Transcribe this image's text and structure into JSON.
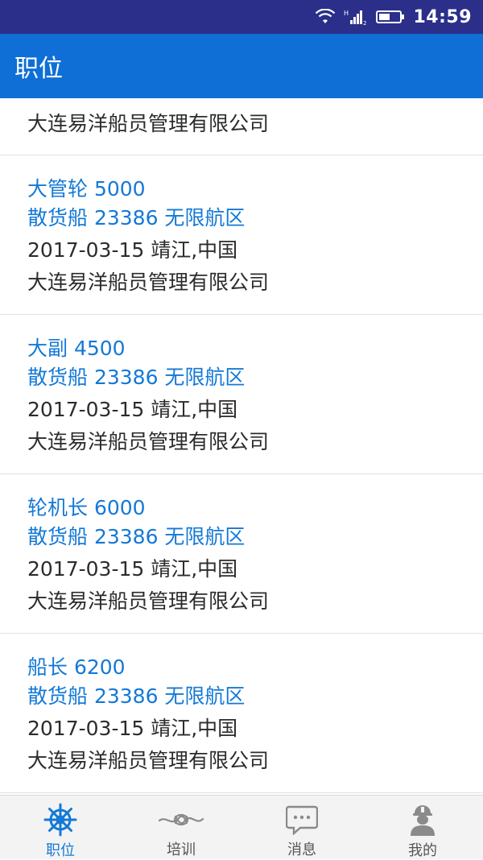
{
  "status": {
    "time": "14:59"
  },
  "appbar": {
    "title": "职位"
  },
  "jobs": [
    {
      "company": "大连易洋船员管理有限公司"
    },
    {
      "position": "大管轮 5000",
      "ship": "散货船 23386 无限航区",
      "date_place": "2017-03-15 靖江,中国",
      "company": "大连易洋船员管理有限公司"
    },
    {
      "position": "大副 4500",
      "ship": "散货船 23386 无限航区",
      "date_place": "2017-03-15 靖江,中国",
      "company": "大连易洋船员管理有限公司"
    },
    {
      "position": "轮机长 6000",
      "ship": "散货船 23386 无限航区",
      "date_place": "2017-03-15 靖江,中国",
      "company": "大连易洋船员管理有限公司"
    },
    {
      "position": "船长 6200",
      "ship": "散货船 23386 无限航区",
      "date_place": "2017-03-15 靖江,中国",
      "company": "大连易洋船员管理有限公司"
    }
  ],
  "tabs": [
    {
      "label": "职位",
      "icon": "ship-wheel-icon",
      "active": true
    },
    {
      "label": "培训",
      "icon": "rope-knot-icon",
      "active": false
    },
    {
      "label": "消息",
      "icon": "message-icon",
      "active": false
    },
    {
      "label": "我的",
      "icon": "worker-icon",
      "active": false
    }
  ],
  "colors": {
    "statusbar": "#2b2f8a",
    "appbar": "#0f6fd6",
    "accent": "#1479d6",
    "text": "#2c2c2c"
  }
}
